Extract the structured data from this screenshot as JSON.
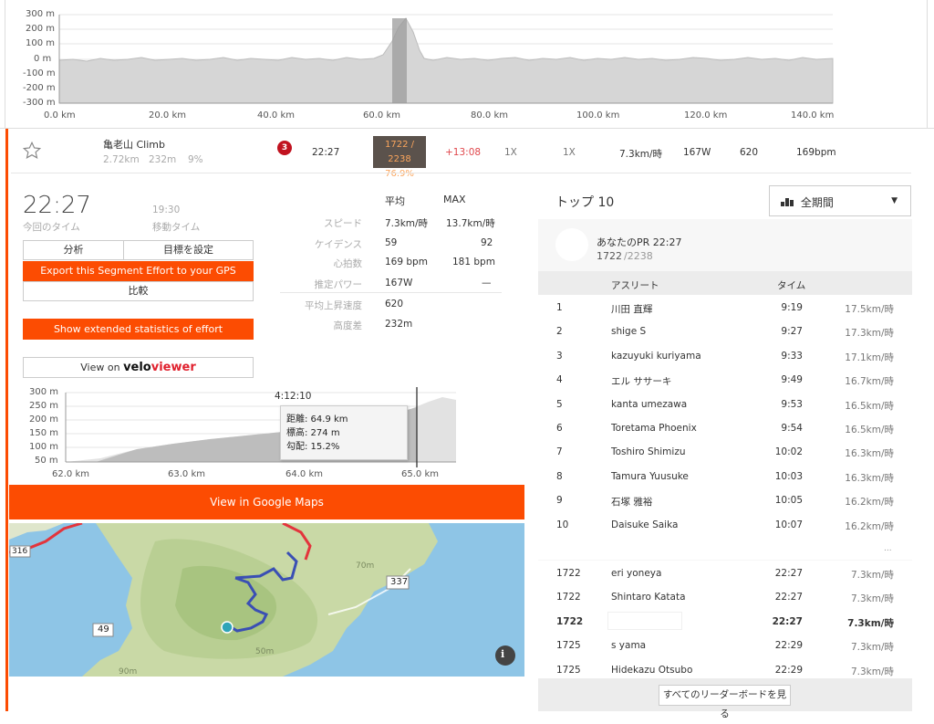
{
  "top_chart": {
    "y_ticks": [
      "300 m",
      "200 m",
      "100 m",
      "0 m",
      "-100 m",
      "-200 m",
      "-300 m"
    ],
    "x_ticks": [
      "0.0 km",
      "20.0 km",
      "40.0 km",
      "60.0 km",
      "80.0 km",
      "100.0 km",
      "120.0 km",
      "140.0 km"
    ]
  },
  "segment": {
    "name": "亀老山 Climb",
    "distance": "2.72km",
    "elevation": "232m",
    "grade": "9%",
    "category": "3",
    "time": "22:27",
    "rank": "1722 / 2238",
    "percentile": "76.9%",
    "behind": "+13:08",
    "col1": "1X",
    "col2": "1X",
    "speed": "7.3km/時",
    "power": "167W",
    "vam": "620",
    "hr": "169bpm"
  },
  "effort": {
    "time": "22:27",
    "time_label": "今回のタイム",
    "moving_time": "19:30",
    "moving_label": "移動タイム",
    "btn_analyze": "分析",
    "btn_goal": "目標を設定",
    "btn_export": "Export this Segment Effort to your GPS",
    "btn_compare": "比較",
    "btn_extended": "Show extended statistics of effort",
    "btn_view_on": "View on",
    "veloviewer_velo": "velo",
    "veloviewer_viewer": "viewer",
    "btn_maps": "View in Google Maps"
  },
  "stats": {
    "head_avg": "平均",
    "head_max": "MAX",
    "rows": [
      {
        "label": "スピード",
        "avg": "7.3km/時",
        "max": "13.7km/時"
      },
      {
        "label": "ケイデンス",
        "avg": "59",
        "max": "92"
      },
      {
        "label": "心拍数",
        "avg": "169 bpm",
        "max": "181 bpm"
      },
      {
        "label": "推定パワー",
        "avg": "167W",
        "max": "—"
      },
      {
        "label": "平均上昇速度",
        "avg": "620",
        "max": ""
      },
      {
        "label": "高度差",
        "avg": "232m",
        "max": ""
      }
    ]
  },
  "mini_chart": {
    "y_ticks": [
      "300 m",
      "250 m",
      "200 m",
      "150 m",
      "100 m",
      "50 m"
    ],
    "x_ticks": [
      "62.0 km",
      "63.0 km",
      "64.0 km",
      "65.0 km"
    ],
    "cursor_time": "4:12:10",
    "tooltip_distance": "距離: 64.9 km",
    "tooltip_elevation": "標高: 274 m",
    "tooltip_grade": "勾配: 15.2%"
  },
  "map": {
    "labels": [
      "337",
      "49",
      "316"
    ],
    "contour_labels": [
      "70m",
      "50m",
      "90m"
    ],
    "info_icon": "info-icon"
  },
  "leaderboard": {
    "title": "トップ 10",
    "filter": "全期間",
    "pr_label": "あなたのPR 22:27",
    "pr_rank": "1722",
    "pr_total": "/2238",
    "col_athlete": "アスリート",
    "col_time": "タイム",
    "rows": [
      {
        "rank": "1",
        "name": "川田 直輝",
        "time": "9:19",
        "speed": "17.5km/時"
      },
      {
        "rank": "2",
        "name": "shige S",
        "time": "9:27",
        "speed": "17.3km/時"
      },
      {
        "rank": "3",
        "name": "kazuyuki kuriyama",
        "time": "9:33",
        "speed": "17.1km/時"
      },
      {
        "rank": "4",
        "name": "エル ササーキ",
        "time": "9:49",
        "speed": "16.7km/時"
      },
      {
        "rank": "5",
        "name": "kanta umezawa",
        "time": "9:53",
        "speed": "16.5km/時"
      },
      {
        "rank": "6",
        "name": "Toretama Phoenix",
        "time": "9:54",
        "speed": "16.5km/時"
      },
      {
        "rank": "7",
        "name": "Toshiro Shimizu",
        "time": "10:02",
        "speed": "16.3km/時"
      },
      {
        "rank": "8",
        "name": "Tamura Yuusuke",
        "time": "10:03",
        "speed": "16.3km/時"
      },
      {
        "rank": "9",
        "name": "石塚 雅裕",
        "time": "10:05",
        "speed": "16.2km/時"
      },
      {
        "rank": "10",
        "name": "Daisuke Saika",
        "time": "10:07",
        "speed": "16.2km/時"
      }
    ],
    "ellipsis": "...",
    "nearby": [
      {
        "rank": "1722",
        "name": "eri yoneya",
        "time": "22:27",
        "speed": "7.3km/時",
        "bold": false
      },
      {
        "rank": "1722",
        "name": "Shintaro Katata",
        "time": "22:27",
        "speed": "7.3km/時",
        "bold": false
      },
      {
        "rank": "1722",
        "name": "",
        "time": "22:27",
        "speed": "7.3km/時",
        "bold": true
      },
      {
        "rank": "1725",
        "name": "s yama",
        "time": "22:29",
        "speed": "7.3km/時",
        "bold": false
      },
      {
        "rank": "1725",
        "name": "Hidekazu Otsubo",
        "time": "22:29",
        "speed": "7.3km/時",
        "bold": false
      }
    ],
    "see_all": "すべてのリーダーボードを見る"
  }
}
